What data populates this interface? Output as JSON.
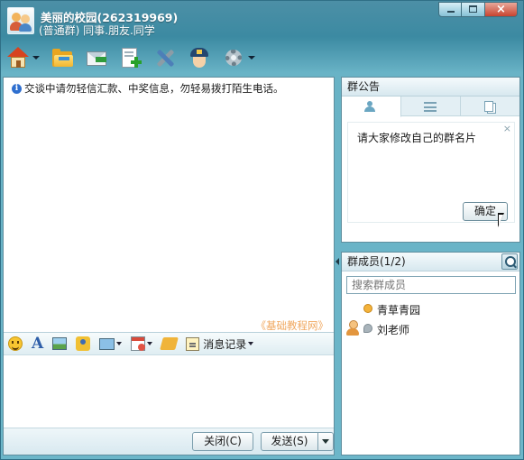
{
  "window": {
    "group_name": "美丽的校园(262319969)",
    "group_subtitle": "(普通群) 同事.朋友.同学"
  },
  "toolbar": {
    "buttons": [
      {
        "name": "home",
        "icon": "home-icon",
        "has_dropdown": true
      },
      {
        "name": "share-file",
        "icon": "folder-icon",
        "has_dropdown": false
      },
      {
        "name": "send-mail",
        "icon": "mail-icon",
        "has_dropdown": false
      },
      {
        "name": "create",
        "icon": "add-document-icon",
        "has_dropdown": false
      },
      {
        "name": "tools",
        "icon": "tools-icon",
        "has_dropdown": false
      },
      {
        "name": "police",
        "icon": "police-icon",
        "has_dropdown": false
      },
      {
        "name": "settings",
        "icon": "gear-icon",
        "has_dropdown": true
      }
    ]
  },
  "chat": {
    "warning": "交谈中请勿轻信汇款、中奖信息，勿轻易拨打陌生电话。",
    "watermark": "《基础教程网》",
    "message_record_label": "消息记录",
    "close_label": "关闭(C)",
    "send_label": "发送(S)"
  },
  "notice": {
    "title": "群公告",
    "text": "请大家修改自己的群名片",
    "ok_label": "确定",
    "close_glyph": "×"
  },
  "members": {
    "title": "群成员(1/2)",
    "search_placeholder": "搜索群成员",
    "list": [
      {
        "name": "青草青园",
        "status": "online",
        "role": "member"
      },
      {
        "name": "刘老师",
        "status": "offline",
        "role": "admin"
      }
    ]
  }
}
